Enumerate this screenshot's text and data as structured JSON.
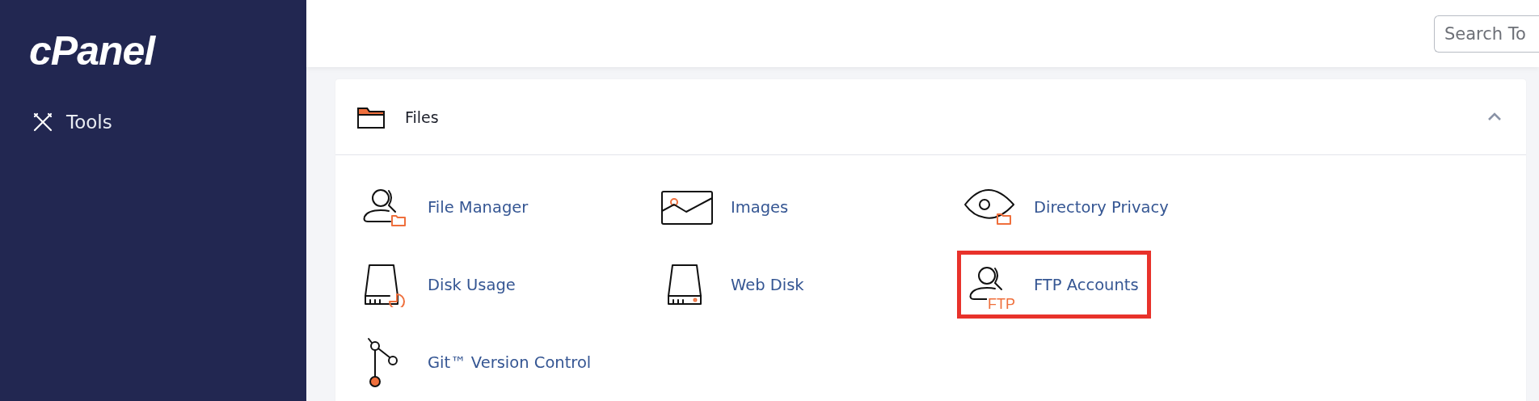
{
  "sidebar": {
    "logo": "cPanel",
    "items": [
      {
        "label": "Tools",
        "kind": "tools"
      }
    ]
  },
  "search": {
    "placeholder": "Search To"
  },
  "section": {
    "title": "Files",
    "expanded": true,
    "items": [
      {
        "label": "File Manager",
        "kind": "file-manager",
        "highlighted": false
      },
      {
        "label": "Images",
        "kind": "images",
        "highlighted": false
      },
      {
        "label": "Directory Privacy",
        "kind": "directory-privacy",
        "highlighted": false
      },
      {
        "label": "Disk Usage",
        "kind": "disk-usage",
        "highlighted": false
      },
      {
        "label": "Web Disk",
        "kind": "web-disk",
        "highlighted": false
      },
      {
        "label": "FTP Accounts",
        "kind": "ftp-accounts",
        "badge": "FTP",
        "highlighted": true
      },
      {
        "label": "Git™ Version Control",
        "kind": "git",
        "highlighted": false
      }
    ]
  }
}
